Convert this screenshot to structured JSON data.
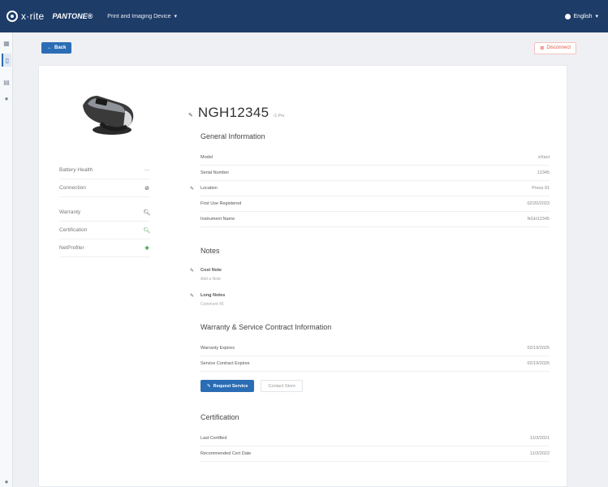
{
  "topbar": {
    "logo_text": "x·rite",
    "pantone_text": "PANTONE®",
    "menu_label": "Print and Imaging Device",
    "language_label": "English"
  },
  "actions": {
    "back_label": "Back",
    "disconnect_label": "Disconnect"
  },
  "left_panel": {
    "battery_label": "Battery Health",
    "battery_value": "---",
    "connection_label": "Connection",
    "warranty_label": "Warranty",
    "certification_label": "Certification",
    "netprofiler_label": "NetProfiler"
  },
  "device": {
    "name": "NGH12345",
    "subtitle": "i1 Pro"
  },
  "general": {
    "title": "General Information",
    "rows": [
      {
        "label": "Model",
        "value": "eXact"
      },
      {
        "label": "Serial Number",
        "value": "12345"
      },
      {
        "label": "Location",
        "value": "Press 01"
      },
      {
        "label": "First Use Registered",
        "value": "02/20/2023"
      },
      {
        "label": "Instrument Name",
        "value": "NGH12345"
      }
    ]
  },
  "notes": {
    "title": "Notes",
    "items": [
      {
        "title": "Cost Note",
        "text": "Add a Note"
      },
      {
        "title": "Long Notes",
        "text": "Comment 45"
      }
    ]
  },
  "warranty": {
    "title": "Warranty & Service Contract Information",
    "rows": [
      {
        "label": "Warranty Expires",
        "value": "02/19/2025"
      },
      {
        "label": "Service Contract Expires",
        "value": "02/19/2025"
      }
    ],
    "request_label": "Request Service",
    "contact_label": "Contact Store"
  },
  "certification": {
    "title": "Certification",
    "rows": [
      {
        "label": "Last Certified",
        "value": "11/3/2021"
      },
      {
        "label": "Recommended Cert Date",
        "value": "11/3/2022"
      }
    ]
  },
  "colors": {
    "topbar": "#1d3c68",
    "accent": "#2a6db5",
    "danger": "#e05a4a",
    "success": "#3b9b4e"
  }
}
